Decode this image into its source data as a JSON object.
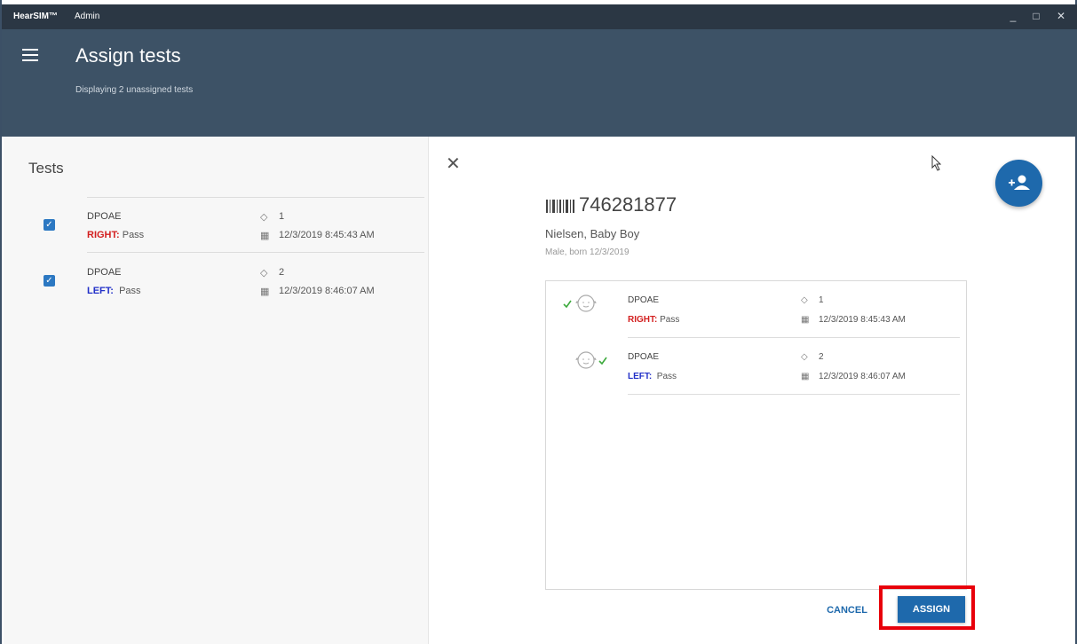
{
  "titlebar": {
    "app_name": "HearSIM™",
    "section": "Admin",
    "minimize": "_",
    "maximize": "□",
    "close": "✕"
  },
  "header": {
    "title": "Assign tests",
    "subtitle": "Displaying 2 unassigned tests"
  },
  "left_panel": {
    "title": "Tests",
    "tests": [
      {
        "checked": true,
        "name": "DPOAE",
        "side_label": "RIGHT:",
        "result": " Pass",
        "tag": "1",
        "datetime": "12/3/2019 8:45:43 AM"
      },
      {
        "checked": true,
        "name": "DPOAE",
        "side_label": "LEFT:",
        "result": "  Pass",
        "tag": "2",
        "datetime": "12/3/2019 8:46:07 AM"
      }
    ]
  },
  "patient": {
    "id": "746281877",
    "name": "Nielsen, Baby Boy",
    "info": "Male, born 12/3/2019"
  },
  "assigned_tests": [
    {
      "name": "DPOAE",
      "side_label": "RIGHT:",
      "result": " Pass",
      "tag": "1",
      "datetime": "12/3/2019 8:45:43 AM"
    },
    {
      "name": "DPOAE",
      "side_label": "LEFT:",
      "result": "  Pass",
      "tag": "2",
      "datetime": "12/3/2019 8:46:07 AM"
    }
  ],
  "actions": {
    "cancel": "CANCEL",
    "assign": "ASSIGN"
  },
  "icons": {
    "close": "✕",
    "tag": "◇",
    "calendar": "▦",
    "check": "✓"
  },
  "colors": {
    "right": "#d32020",
    "left": "#2230c8",
    "accent": "#1e69ac",
    "header": "#3d5266",
    "highlight": "#e8000b"
  }
}
